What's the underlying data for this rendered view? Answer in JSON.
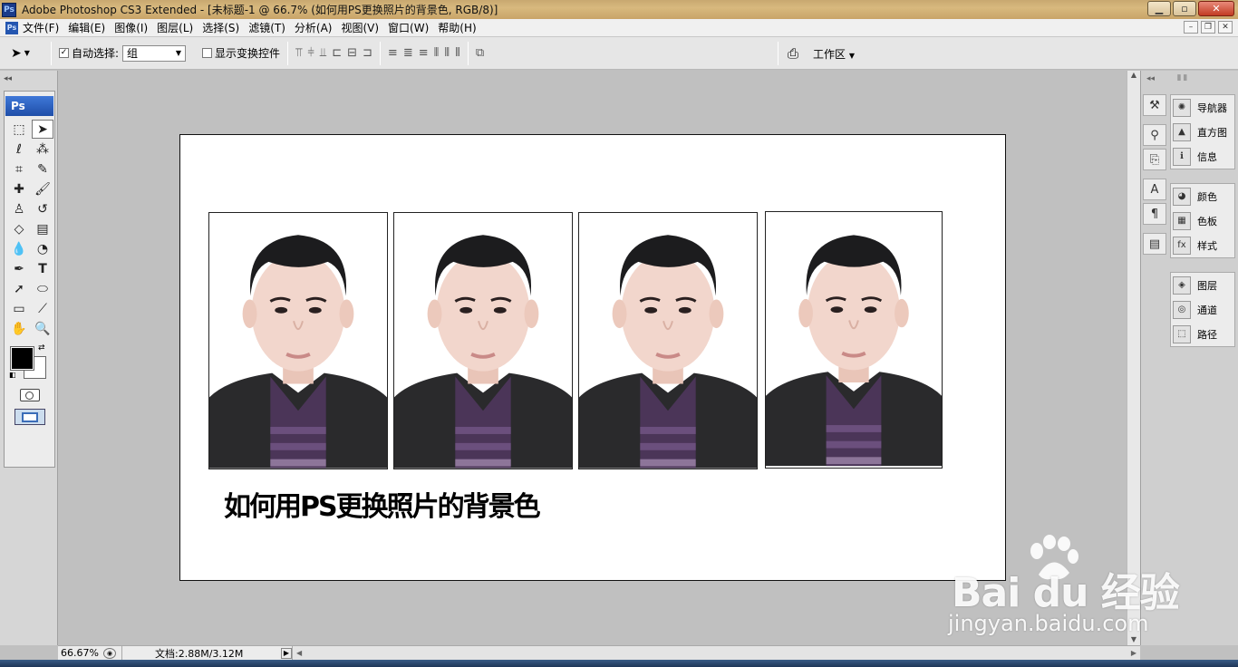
{
  "window": {
    "app_icon": "Ps",
    "title": "Adobe Photoshop CS3 Extended - [未标题-1 @ 66.7% (如何用PS更换照片的背景色, RGB/8)]"
  },
  "menu": {
    "items": [
      "文件(F)",
      "编辑(E)",
      "图像(I)",
      "图层(L)",
      "选择(S)",
      "滤镜(T)",
      "分析(A)",
      "视图(V)",
      "窗口(W)",
      "帮助(H)"
    ]
  },
  "options": {
    "auto_select_label": "自动选择:",
    "auto_select_checked": true,
    "auto_select_value": "组",
    "show_transform_label": "显示变换控件",
    "show_transform_checked": false,
    "workspace_label": "工作区"
  },
  "toolbox": {
    "badge": "Ps",
    "foreground_color": "#000000",
    "background_color": "#ffffff"
  },
  "panels": {
    "group1": [
      "导航器",
      "直方图",
      "信息"
    ],
    "group2": [
      "颜色",
      "色板",
      "样式"
    ],
    "group3": [
      "图层",
      "通道",
      "路径"
    ]
  },
  "document": {
    "caption": "如何用PS更换照片的背景色",
    "photo_count": 4
  },
  "status": {
    "zoom": "66.67%",
    "doc_info": "文档:2.88M/3.12M"
  },
  "watermark": {
    "brand": "Bai du 经验",
    "url": "jingyan.baidu.com"
  }
}
